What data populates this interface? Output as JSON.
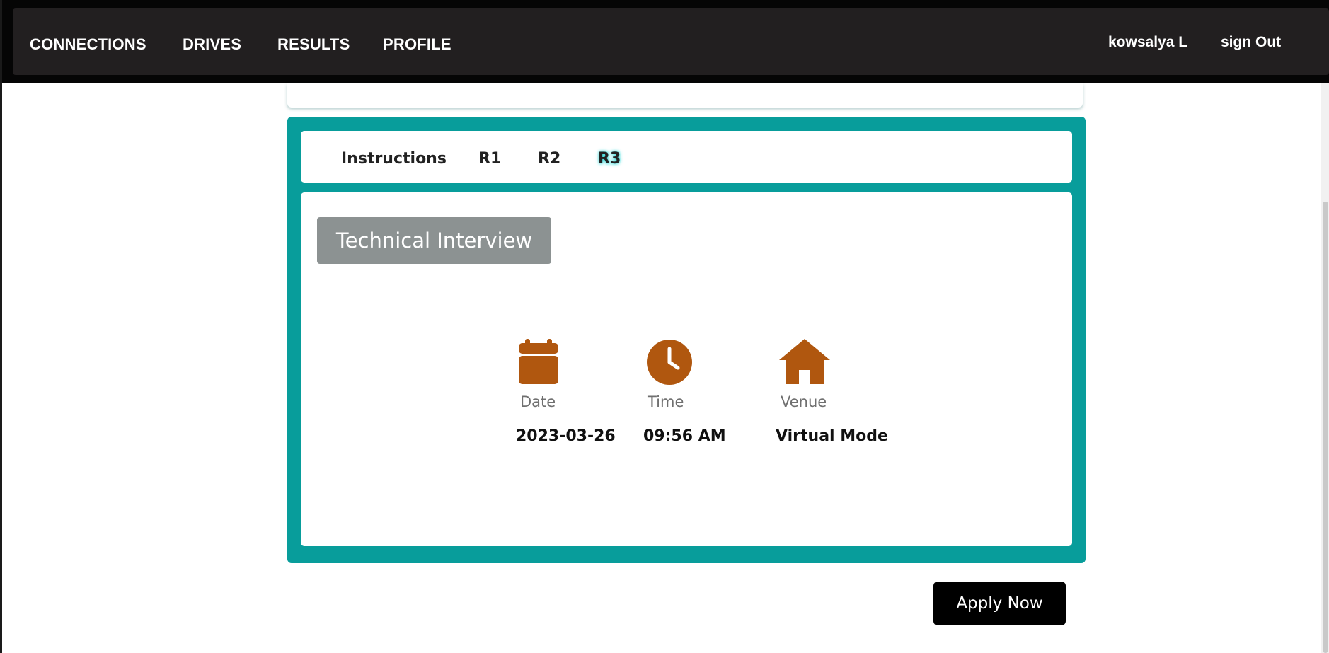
{
  "nav": {
    "links": [
      "CONNECTIONS",
      "DRIVES",
      "RESULTS",
      "PROFILE"
    ],
    "user_name": "kowsalya L",
    "sign_out_label": "sign Out"
  },
  "tabs": [
    {
      "label": "Instructions",
      "active": false
    },
    {
      "label": "R1",
      "active": false
    },
    {
      "label": "R2",
      "active": false
    },
    {
      "label": "R3",
      "active": true
    }
  ],
  "round": {
    "title": "Technical Interview",
    "details": [
      {
        "icon": "calendar-icon",
        "label": "Date",
        "value": "2023-03-26"
      },
      {
        "icon": "clock-icon",
        "label": "Time",
        "value": "09:56 AM"
      },
      {
        "icon": "house-icon",
        "label": "Venue",
        "value": "Virtual Mode"
      }
    ]
  },
  "apply_label": "Apply Now",
  "colors": {
    "nav_bg": "#221f20",
    "teal": "#089d9b",
    "icon_orange": "#b0570f",
    "badge_grey": "#8c9292"
  }
}
